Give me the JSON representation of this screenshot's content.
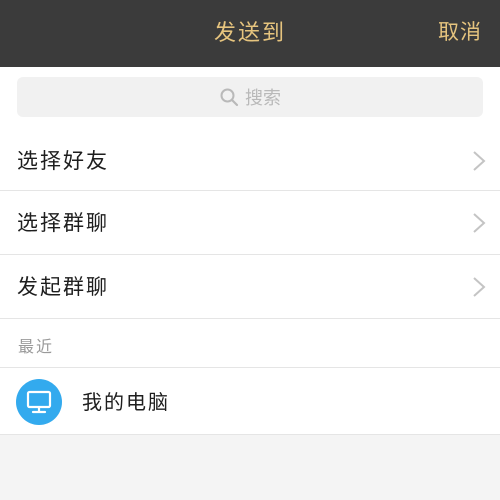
{
  "header": {
    "title": "发送到",
    "cancel_label": "取消",
    "background": "#3b3b3b",
    "text_color": "#e6c47e"
  },
  "search": {
    "placeholder": "搜索",
    "icon": "search-icon"
  },
  "menu": {
    "items": [
      {
        "label": "选择好友",
        "icon": "chevron-right-icon"
      },
      {
        "label": "选择群聊",
        "icon": "chevron-right-icon"
      },
      {
        "label": "发起群聊",
        "icon": "chevron-right-icon"
      }
    ]
  },
  "recent": {
    "section_label": "最近",
    "items": [
      {
        "name": "我的电脑",
        "icon": "computer-icon",
        "avatar_color": "#33aaee"
      }
    ]
  }
}
